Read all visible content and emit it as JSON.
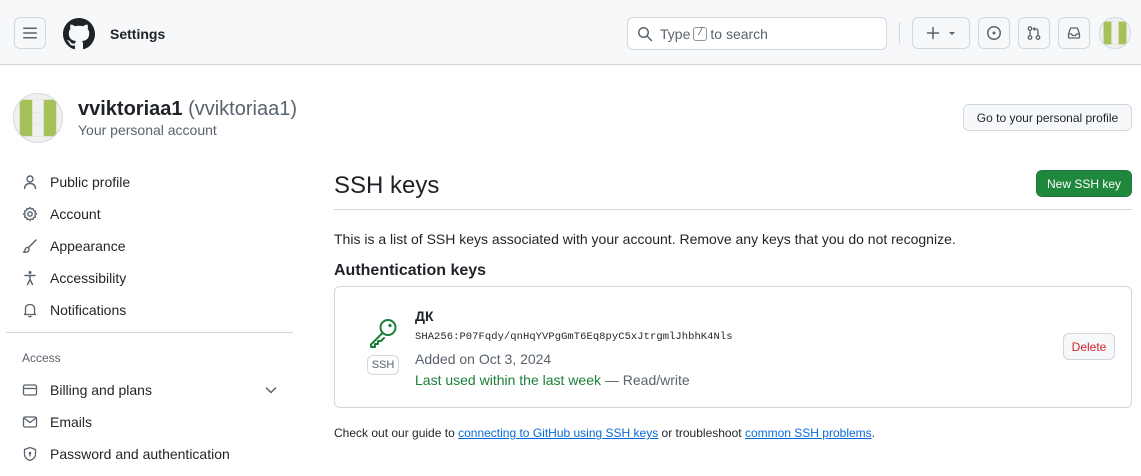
{
  "header": {
    "context": "Settings",
    "search": {
      "prefix": "Type",
      "key": "/",
      "suffix": "to search"
    }
  },
  "account": {
    "username": "vviktoriaa1",
    "handle": "(vviktoriaa1)",
    "subtitle": "Your personal account",
    "profile_button": "Go to your personal profile"
  },
  "sidebar": {
    "items": [
      {
        "label": "Public profile",
        "icon": "person-icon"
      },
      {
        "label": "Account",
        "icon": "gear-icon"
      },
      {
        "label": "Appearance",
        "icon": "paintbrush-icon"
      },
      {
        "label": "Accessibility",
        "icon": "accessibility-icon"
      },
      {
        "label": "Notifications",
        "icon": "bell-icon"
      }
    ],
    "access_heading": "Access",
    "access_items": [
      {
        "label": "Billing and plans",
        "icon": "credit-card-icon"
      },
      {
        "label": "Emails",
        "icon": "mail-icon"
      },
      {
        "label": "Password and authentication",
        "icon": "shield-lock-icon"
      }
    ]
  },
  "main": {
    "title": "SSH keys",
    "new_button": "New SSH key",
    "intro": "This is a list of SSH keys associated with your account. Remove any keys that you do not recognize.",
    "auth_heading": "Authentication keys",
    "keys": [
      {
        "name": "ДК",
        "fingerprint": "SHA256:P07Fqdy/qnHqYVPgGmT6Eq8pyC5xJtrgmlJhbhK4Nls",
        "added": "Added on Oct 3, 2024",
        "last_used": "Last used within the last week",
        "access": "— Read/write",
        "badge": "SSH",
        "delete_label": "Delete"
      }
    ],
    "guide": {
      "prefix": "Check out our guide to",
      "link1": "connecting to GitHub using SSH keys",
      "middle": "or troubleshoot",
      "link2": "common SSH problems",
      "suffix": "."
    }
  },
  "colors": {
    "primary_button": "#1f883d",
    "danger": "#d1242f",
    "link": "#0969da",
    "success": "#1a7f37",
    "avatar": "#a6c15a"
  }
}
